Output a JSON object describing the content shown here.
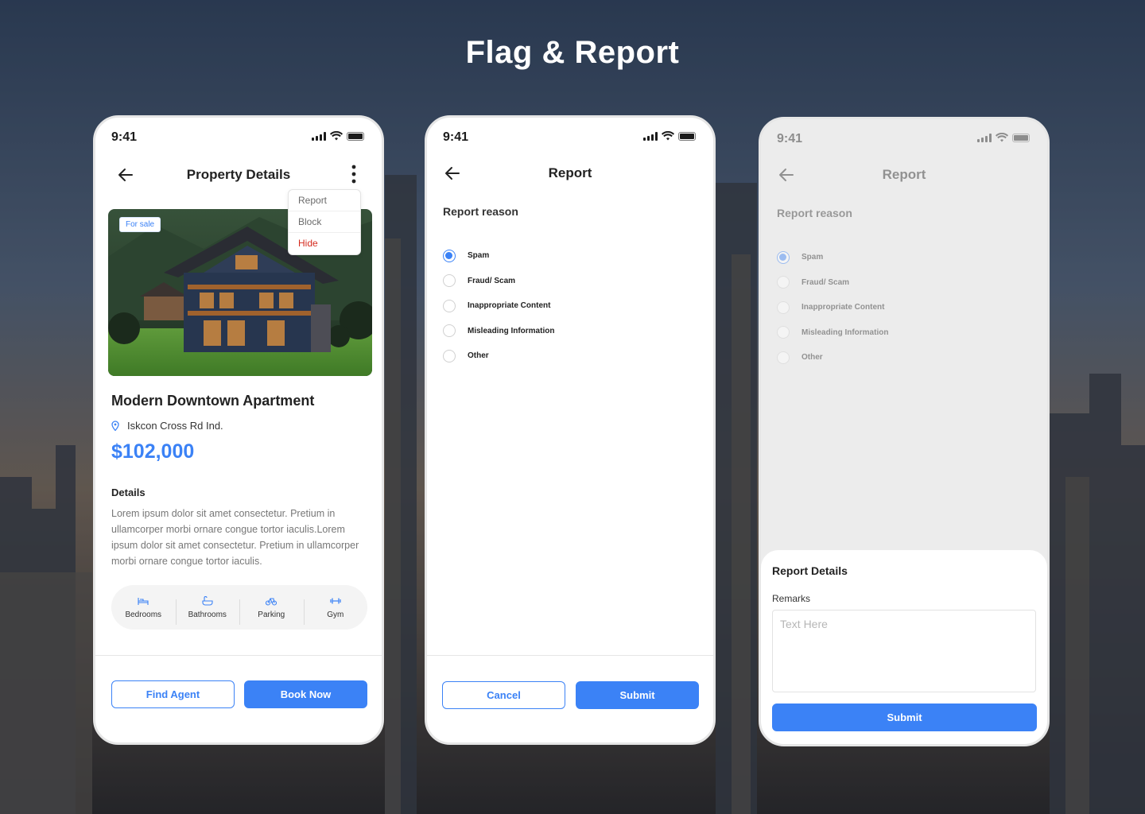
{
  "page_title": "Flag & Report",
  "colors": {
    "accent": "#3b82f6",
    "danger": "#d52b1e"
  },
  "screen1": {
    "time": "9:41",
    "nav_title": "Property Details",
    "menu": [
      "Report",
      "Block",
      "Hide"
    ],
    "badge": "For sale",
    "property_title": "Modern Downtown Apartment",
    "location": "Iskcon Cross Rd Ind.",
    "price": "$102,000",
    "details_heading": "Details",
    "details_text": "Lorem ipsum dolor sit amet consectetur. Pretium in ullamcorper morbi ornare congue tortor iaculis.Lorem ipsum dolor sit amet consectetur. Pretium in ullamcorper morbi ornare congue tortor iaculis.",
    "features": [
      {
        "label": "Bedrooms",
        "icon": "bed-icon"
      },
      {
        "label": "Bathrooms",
        "icon": "bathtub-icon"
      },
      {
        "label": "Parking",
        "icon": "bicycle-icon"
      },
      {
        "label": "Gym",
        "icon": "dumbbell-icon"
      }
    ],
    "find_agent": "Find Agent",
    "book_now": "Book Now"
  },
  "screen2": {
    "time": "9:41",
    "nav_title": "Report",
    "section": "Report reason",
    "reasons": [
      "Spam",
      "Fraud/ Scam",
      "Inappropriate Content",
      "Misleading Information",
      "Other"
    ],
    "selected": "Spam",
    "cancel": "Cancel",
    "submit": "Submit"
  },
  "screen3": {
    "time": "9:41",
    "nav_title": "Report",
    "section": "Report reason",
    "reasons": [
      "Spam",
      "Fraud/ Scam",
      "Inappropriate Content",
      "Misleading Information",
      "Other"
    ],
    "selected": "Spam",
    "sheet_title": "Report Details",
    "remarks_label": "Remarks",
    "remarks_placeholder": "Text Here",
    "submit": "Submit"
  }
}
